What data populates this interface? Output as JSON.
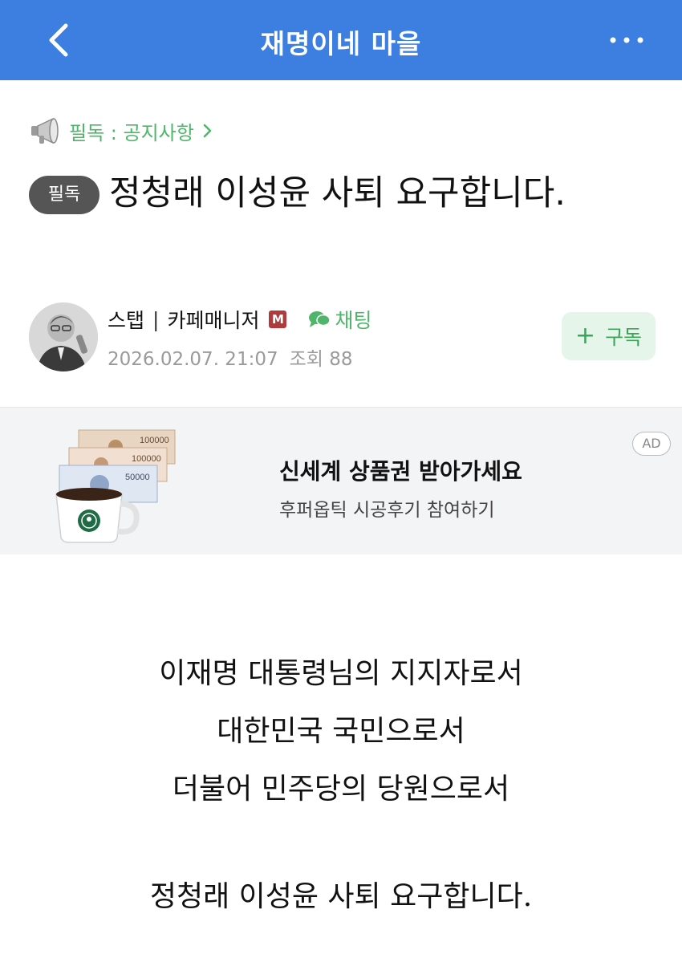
{
  "topbar": {
    "title": "재명이네 마을",
    "back_icon": "chevron-left-icon",
    "more_icon": "more-horizontal-icon"
  },
  "notice": {
    "icon": "megaphone-icon",
    "label": "필독 : 공지사항"
  },
  "post": {
    "badge": "필독",
    "title": "정청래 이성윤 사퇴 요구합니다."
  },
  "author": {
    "name": "스탭",
    "separator": "|",
    "role": "카페매니저",
    "manager_badge": "M",
    "chat_label": "채팅",
    "date": "2026.02.07. 21:07",
    "views": "조회 88"
  },
  "subscribe": {
    "plus": "+",
    "label": "구독"
  },
  "ad": {
    "title": "신세계 상품권 받아가세요",
    "subtitle": "후퍼옵틱 시공후기 참여하기",
    "mark": "AD",
    "voucher_1": "100000",
    "voucher_2": "100000",
    "voucher_3": "50000"
  },
  "content": {
    "lines": [
      "이재명 대통령님의 지지자로서",
      "대한민국 국민으로서",
      "더불어 민주당의 당원으로서",
      "정청래 이성윤 사퇴 요구합니다."
    ]
  },
  "colors": {
    "header_blue": "#3d7fe0",
    "accent_green": "#4fb56a",
    "badge_gray": "#555555"
  }
}
